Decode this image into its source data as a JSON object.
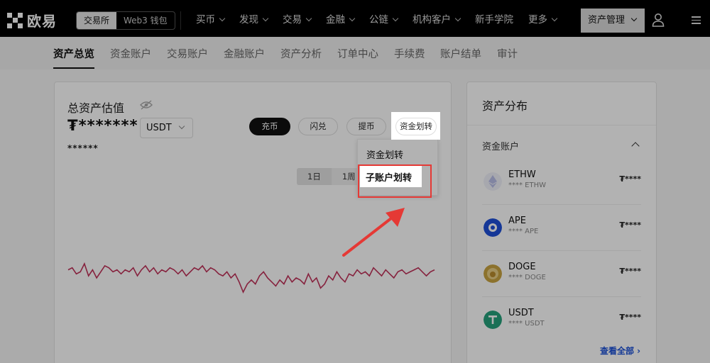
{
  "header": {
    "logo_text": "欧易",
    "segment": [
      "交易所",
      "Web3 钱包"
    ],
    "nav": [
      "买币",
      "发现",
      "交易",
      "金融",
      "公链",
      "机构客户",
      "新手学院",
      "更多"
    ],
    "asset_button": "资产管理"
  },
  "tabs": [
    "资产总览",
    "资金账户",
    "交易账户",
    "金融账户",
    "资产分析",
    "订单中心",
    "手续费",
    "账户结单",
    "审计"
  ],
  "overview": {
    "title": "总资产估值",
    "value": "₮*******",
    "sub_value": "******",
    "currency": "USDT",
    "buttons": {
      "deposit": "充币",
      "convert": "闪兑",
      "withdraw": "提币",
      "transfer": "资金划转"
    },
    "ranges": [
      "1日",
      "1周"
    ],
    "dropdown": {
      "item1": "资金划转",
      "item2": "子账户划转"
    }
  },
  "distribution": {
    "title": "资产分布",
    "section": "资金账户",
    "coins": [
      {
        "symbol": "ETHW",
        "sub": "**** ETHW",
        "value": "₮****",
        "color": "#d8dcf5",
        "icon": "ethw-icon"
      },
      {
        "symbol": "APE",
        "sub": "**** APE",
        "value": "₮****",
        "color": "#1f4fd8",
        "icon": "ape-icon"
      },
      {
        "symbol": "DOGE",
        "sub": "**** DOGE",
        "value": "₮****",
        "color": "#c9a441",
        "icon": "doge-icon"
      },
      {
        "symbol": "USDT",
        "sub": "**** USDT",
        "value": "₮****",
        "color": "#26a17b",
        "icon": "usdt-icon"
      }
    ],
    "view_all": "查看全部 ›"
  },
  "chart_data": {
    "type": "line",
    "series_color": "#c0325a",
    "values": [
      30,
      31,
      28,
      29,
      33,
      27,
      30,
      26,
      29,
      32,
      31,
      29,
      30,
      28,
      30,
      29,
      31,
      27,
      30,
      32,
      29,
      31,
      28,
      30,
      29,
      31,
      30,
      28,
      30,
      27,
      29,
      31,
      30,
      32,
      29,
      31,
      30,
      28,
      27,
      29,
      26,
      28,
      24,
      19,
      23,
      25,
      23,
      27,
      29,
      26,
      24,
      22,
      25,
      23,
      27,
      24,
      26,
      25,
      23,
      28,
      24,
      26,
      21,
      23,
      27,
      25,
      29,
      26,
      24,
      28,
      27,
      30,
      28,
      29,
      27,
      31,
      29,
      27,
      30,
      28,
      26,
      29,
      30,
      28,
      29,
      30,
      31,
      29,
      27,
      29,
      30
    ]
  }
}
